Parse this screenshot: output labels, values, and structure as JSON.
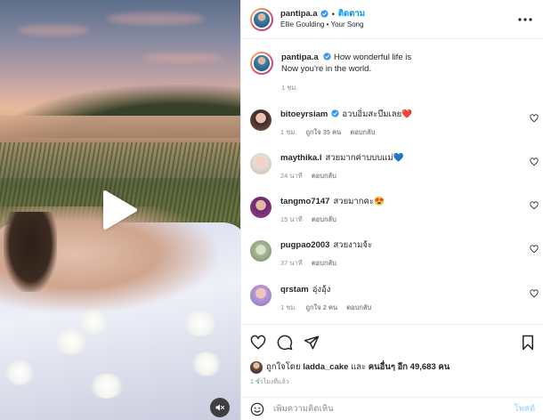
{
  "header": {
    "username": "pantipa.a",
    "separator": "•",
    "follow_label": "ติดตาม",
    "music": "Ellie Goulding • Your Song",
    "more_icon": "more-horizontal-icon"
  },
  "caption": {
    "username": "pantipa.a",
    "text": "How wonderful life is\nNow you're in the world.",
    "time": "1 ชม."
  },
  "comments": [
    {
      "username": "bitoeyrsiam",
      "verified": true,
      "text": "อวบอิ่มสะบึมเลย",
      "emoji": "❤️",
      "time": "1 ชม.",
      "likes": "ถูกใจ 35 คน",
      "reply": "ตอบกลับ"
    },
    {
      "username": "maythika.l",
      "verified": false,
      "text": "สวยมากค่าบบบแม่",
      "emoji": "💙",
      "time": "24 นาที",
      "likes": "",
      "reply": "ตอบกลับ"
    },
    {
      "username": "tangmo7147",
      "verified": false,
      "text": "สวยมากคะ",
      "emoji": "😍",
      "time": "15 นาที",
      "likes": "",
      "reply": "ตอบกลับ"
    },
    {
      "username": "pugpao2003",
      "verified": false,
      "text": "สวยงามจ้ะ",
      "emoji": "",
      "time": "37 นาที",
      "likes": "",
      "reply": "ตอบกลับ"
    },
    {
      "username": "qrstam",
      "verified": false,
      "text": "อุ่งอุ้ง",
      "emoji": "",
      "time": "1 ชม.",
      "likes": "ถูกใจ 2 คน",
      "reply": "ตอบกลับ"
    }
  ],
  "likes": {
    "prefix": "ถูกใจโดย",
    "user": "ladda_cake",
    "and": "และ",
    "others": "คนอื่นๆ อีก 49,683 คน"
  },
  "post_time": "1 ชั่วโมงที่แล้ว",
  "composer": {
    "placeholder": "เพิ่มความคิดเห็น",
    "post_label": "โพสต์"
  },
  "colors": {
    "accent": "#0095f6",
    "verified": "#3897f0",
    "heart": "#ed4956",
    "post_disabled": "#b2dffc"
  }
}
